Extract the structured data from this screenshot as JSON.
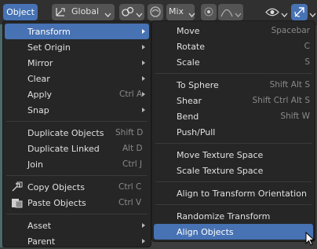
{
  "header": {
    "object_menu": "Object",
    "orientation": "Global",
    "pivot": "Mix"
  },
  "object_menu": {
    "items": [
      {
        "label": "Transform",
        "submenu": true,
        "highlighted": true
      },
      {
        "label": "Set Origin",
        "submenu": true
      },
      {
        "label": "Mirror",
        "submenu": true
      },
      {
        "label": "Clear",
        "submenu": true
      },
      {
        "label": "Apply",
        "shortcut": "Ctrl A",
        "submenu": true
      },
      {
        "label": "Snap",
        "submenu": true
      },
      {
        "label": "Duplicate Objects",
        "shortcut": "Shift D"
      },
      {
        "label": "Duplicate Linked",
        "shortcut": "Alt D"
      },
      {
        "label": "Join",
        "shortcut": "Ctrl J"
      },
      {
        "label": "Copy Objects",
        "shortcut": "Ctrl C",
        "icon": "copy-icon"
      },
      {
        "label": "Paste Objects",
        "shortcut": "Ctrl V",
        "icon": "paste-icon"
      },
      {
        "label": "Asset",
        "submenu": true
      },
      {
        "label": "Parent",
        "submenu": true
      }
    ]
  },
  "transform_menu": {
    "items": [
      {
        "label": "Move",
        "shortcut": "Spacebar"
      },
      {
        "label": "Rotate",
        "shortcut": "C"
      },
      {
        "label": "Scale",
        "shortcut": "S"
      },
      {
        "label": "To Sphere",
        "shortcut": "Shift Alt S"
      },
      {
        "label": "Shear",
        "shortcut": "Shift Ctrl Alt S"
      },
      {
        "label": "Bend",
        "shortcut": "Shift W"
      },
      {
        "label": "Push/Pull",
        "shortcut": ""
      },
      {
        "label": "Move Texture Space",
        "shortcut": ""
      },
      {
        "label": "Scale Texture Space",
        "shortcut": ""
      },
      {
        "label": "Align to Transform Orientation",
        "shortcut": ""
      },
      {
        "label": "Randomize Transform",
        "shortcut": ""
      },
      {
        "label": "Align Objects",
        "shortcut": "",
        "highlighted": true
      }
    ]
  },
  "colors": {
    "highlight": "#4772b3",
    "menu_bg": "#262626",
    "header_bg": "#303030"
  }
}
